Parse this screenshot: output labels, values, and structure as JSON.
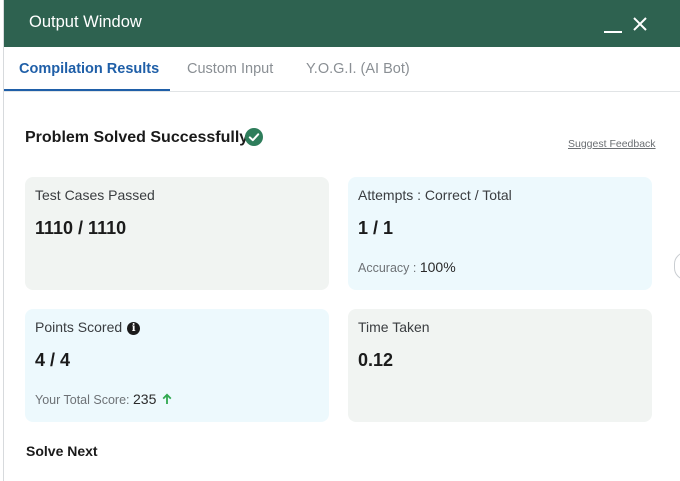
{
  "window": {
    "title": "Output Window"
  },
  "tabs": [
    {
      "label": "Compilation Results",
      "active": true
    },
    {
      "label": "Custom Input",
      "active": false
    },
    {
      "label": "Y.O.G.I. (AI Bot)",
      "active": false
    }
  ],
  "result": {
    "status": "Problem Solved Successfully",
    "feedback_link": "Suggest Feedback"
  },
  "cards": {
    "test_cases": {
      "label": "Test Cases Passed",
      "value": "1110 / 1110"
    },
    "attempts": {
      "label": "Attempts : Correct / Total",
      "value": "1 / 1",
      "accuracy_label": "Accuracy :",
      "accuracy_value": "100%"
    },
    "points": {
      "label": "Points Scored",
      "value": "4 / 4",
      "total_label": "Your Total Score:",
      "total_value": "235"
    },
    "time": {
      "label": "Time Taken",
      "value": "0.12"
    }
  },
  "footer": {
    "solve_next": "Solve Next"
  },
  "colors": {
    "titlebar": "#2e6250",
    "active_tab": "#1f5fa8",
    "success": "#2e7d5b",
    "up_arrow": "#2fa84f",
    "card_grey": "#f1f4f2",
    "card_blue": "#edf9fd"
  },
  "icons": {
    "minimize": "minimize-icon",
    "close": "close-icon",
    "status": "check-circle-icon",
    "points_info": "info-icon",
    "score_trend": "arrow-up-icon"
  }
}
